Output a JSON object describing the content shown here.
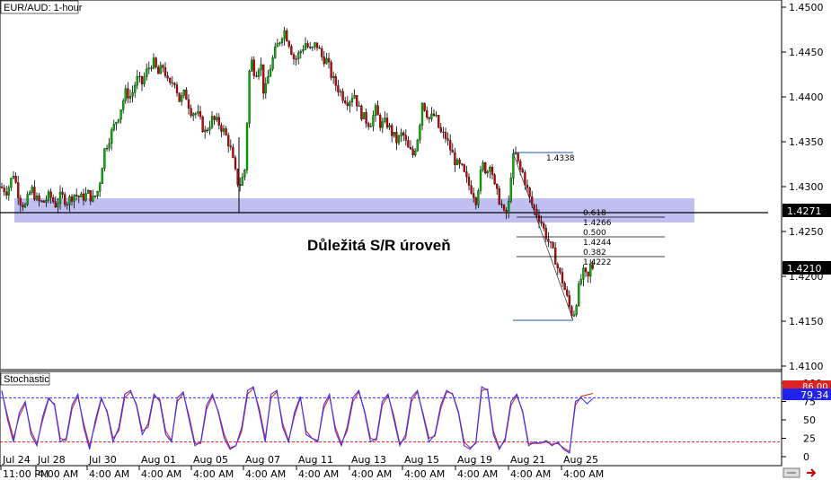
{
  "chart_title": "EUR/AUD: 1-hour",
  "indicator_title": "Stochastic",
  "annotation": "Důležitá S/R úroveň",
  "price_labels": {
    "current": "1.4210",
    "support": "1.4271"
  },
  "stoch_labels": {
    "k": "79.34",
    "d": "86.00"
  },
  "colors": {
    "up_candle": "#00b400",
    "down_candle": "#cc0000",
    "zone": "#8a8ae8",
    "fib_line": "#2255aa",
    "stoch_k": "#3333ff",
    "stoch_d": "#dd2222",
    "level_upper": "#3333ff",
    "level_lower": "#dd2222"
  },
  "chart_data": [
    {
      "type": "candlestick",
      "title": "EUR/AUD: 1-hour",
      "ylim": [
        1.408,
        1.45
      ],
      "yticks": [
        "1.4500",
        "1.4450",
        "1.4400",
        "1.4350",
        "1.4300",
        "1.4250",
        "1.4200",
        "1.4150",
        "1.4100"
      ],
      "x_ticks": [
        "Jul 24 11:00 PM",
        "Jul 28 4:00 AM",
        "Jul 30 4:00 AM",
        "Aug 01 4:00 AM",
        "Aug 05 4:00 AM",
        "Aug 07 4:00 AM",
        "Aug 11 4:00 AM",
        "Aug 13 4:00 AM",
        "Aug 15 4:00 AM",
        "Aug 19 4:00 AM",
        "Aug 21 4:00 AM",
        "Aug 25 4:00 AM"
      ],
      "price_path": [
        [
          0,
          1.43
        ],
        [
          8,
          1.4295
        ],
        [
          15,
          1.4315
        ],
        [
          22,
          1.4285
        ],
        [
          28,
          1.4278
        ],
        [
          35,
          1.4298
        ],
        [
          42,
          1.4283
        ],
        [
          48,
          1.4282
        ],
        [
          55,
          1.429
        ],
        [
          62,
          1.428
        ],
        [
          68,
          1.429
        ],
        [
          75,
          1.4283
        ],
        [
          82,
          1.4292
        ],
        [
          90,
          1.4287
        ],
        [
          98,
          1.4292
        ],
        [
          104,
          1.4285
        ],
        [
          110,
          1.4298
        ],
        [
          116,
          1.434
        ],
        [
          124,
          1.436
        ],
        [
          132,
          1.438
        ],
        [
          140,
          1.4405
        ],
        [
          146,
          1.44
        ],
        [
          152,
          1.442
        ],
        [
          158,
          1.4415
        ],
        [
          164,
          1.443
        ],
        [
          170,
          1.444
        ],
        [
          176,
          1.4425
        ],
        [
          182,
          1.4435
        ],
        [
          188,
          1.441
        ],
        [
          194,
          1.442
        ],
        [
          200,
          1.4395
        ],
        [
          206,
          1.4405
        ],
        [
          212,
          1.4385
        ],
        [
          220,
          1.438
        ],
        [
          228,
          1.436
        ],
        [
          236,
          1.4375
        ],
        [
          244,
          1.437
        ],
        [
          250,
          1.436
        ],
        [
          256,
          1.4345
        ],
        [
          262,
          1.4315
        ],
        [
          266,
          1.43
        ],
        [
          270,
          1.431
        ],
        [
          274,
          1.4325
        ],
        [
          276,
          1.442
        ],
        [
          280,
          1.444
        ],
        [
          284,
          1.4425
        ],
        [
          290,
          1.444
        ],
        [
          294,
          1.44
        ],
        [
          300,
          1.443
        ],
        [
          306,
          1.445
        ],
        [
          312,
          1.4465
        ],
        [
          316,
          1.4475
        ],
        [
          322,
          1.446
        ],
        [
          328,
          1.444
        ],
        [
          334,
          1.445
        ],
        [
          340,
          1.446
        ],
        [
          346,
          1.445
        ],
        [
          352,
          1.446
        ],
        [
          358,
          1.4445
        ],
        [
          364,
          1.444
        ],
        [
          370,
          1.442
        ],
        [
          376,
          1.441
        ],
        [
          382,
          1.44
        ],
        [
          388,
          1.4395
        ],
        [
          394,
          1.4405
        ],
        [
          400,
          1.4385
        ],
        [
          406,
          1.4375
        ],
        [
          412,
          1.437
        ],
        [
          418,
          1.4385
        ],
        [
          424,
          1.4368
        ],
        [
          430,
          1.4372
        ],
        [
          436,
          1.436
        ],
        [
          442,
          1.435
        ],
        [
          448,
          1.436
        ],
        [
          454,
          1.4342
        ],
        [
          460,
          1.4335
        ],
        [
          466,
          1.436
        ],
        [
          470,
          1.4395
        ],
        [
          474,
          1.4385
        ],
        [
          478,
          1.4375
        ],
        [
          484,
          1.438
        ],
        [
          490,
          1.436
        ],
        [
          496,
          1.4355
        ],
        [
          502,
          1.434
        ],
        [
          508,
          1.4325
        ],
        [
          514,
          1.432
        ],
        [
          520,
          1.4305
        ],
        [
          526,
          1.4295
        ],
        [
          530,
          1.4285
        ],
        [
          534,
          1.431
        ],
        [
          538,
          1.4325
        ],
        [
          542,
          1.4315
        ],
        [
          546,
          1.433
        ],
        [
          550,
          1.43
        ],
        [
          554,
          1.429
        ],
        [
          558,
          1.428
        ],
        [
          562,
          1.4265
        ],
        [
          566,
          1.4278
        ],
        [
          570,
          1.433
        ],
        [
          574,
          1.4335
        ],
        [
          578,
          1.432
        ],
        [
          582,
          1.4315
        ],
        [
          586,
          1.43
        ],
        [
          590,
          1.4285
        ],
        [
          594,
          1.4275
        ],
        [
          598,
          1.427
        ],
        [
          602,
          1.4262
        ],
        [
          606,
          1.425
        ],
        [
          610,
          1.424
        ],
        [
          614,
          1.423
        ],
        [
          618,
          1.422
        ],
        [
          622,
          1.4205
        ],
        [
          626,
          1.4195
        ],
        [
          630,
          1.418
        ],
        [
          634,
          1.4165
        ],
        [
          638,
          1.4155
        ],
        [
          642,
          1.4175
        ],
        [
          646,
          1.4195
        ],
        [
          650,
          1.4205
        ],
        [
          654,
          1.4195
        ],
        [
          658,
          1.4215
        ],
        [
          660,
          1.421
        ]
      ],
      "support_level": 1.4271,
      "zone": [
        1.426,
        1.4287
      ],
      "fib_high": {
        "price": 1.4338,
        "label": "1.4338"
      },
      "fib_low": {
        "price": 1.4151
      },
      "fib_levels": [
        {
          "ratio": "0.618",
          "price": 1.4266,
          "price_label": "1.4266"
        },
        {
          "ratio": "0.500",
          "price": 1.4244,
          "price_label": "1.4244"
        },
        {
          "ratio": "0.382",
          "price": 1.4222,
          "price_label": "1.4222"
        }
      ]
    },
    {
      "type": "line",
      "title": "Stochastic",
      "ylim": [
        0,
        100
      ],
      "yticks": [
        "100",
        "75",
        "50",
        "25",
        "0"
      ],
      "levels": [
        80,
        20
      ],
      "series": [
        {
          "name": "%K",
          "values": [
            90,
            50,
            20,
            60,
            75,
            30,
            15,
            55,
            80,
            70,
            20,
            25,
            70,
            85,
            40,
            10,
            50,
            80,
            60,
            20,
            40,
            85,
            90,
            70,
            30,
            45,
            85,
            75,
            30,
            20,
            80,
            88,
            50,
            15,
            20,
            70,
            85,
            60,
            25,
            10,
            15,
            40,
            90,
            95,
            60,
            20,
            85,
            90,
            40,
            20,
            60,
            82,
            30,
            25,
            20,
            70,
            85,
            35,
            15,
            40,
            80,
            90,
            60,
            20,
            25,
            75,
            85,
            50,
            15,
            30,
            80,
            90,
            55,
            20,
            30,
            70,
            90,
            85,
            60,
            15,
            10,
            20,
            95,
            90,
            30,
            10,
            25,
            75,
            85,
            60,
            15,
            20,
            18,
            22,
            15,
            20,
            10,
            5,
            75,
            80,
            72,
            79
          ]
        },
        {
          "name": "%D",
          "values": [
            88,
            55,
            25,
            55,
            72,
            35,
            18,
            50,
            78,
            72,
            25,
            22,
            65,
            82,
            45,
            15,
            45,
            78,
            62,
            25,
            35,
            80,
            88,
            72,
            35,
            40,
            82,
            78,
            35,
            22,
            75,
            86,
            55,
            18,
            18,
            65,
            82,
            62,
            30,
            12,
            15,
            35,
            85,
            93,
            65,
            25,
            80,
            88,
            45,
            22,
            55,
            80,
            35,
            25,
            22,
            65,
            82,
            40,
            18,
            35,
            75,
            88,
            62,
            25,
            22,
            70,
            83,
            55,
            18,
            25,
            75,
            88,
            58,
            25,
            28,
            65,
            88,
            86,
            62,
            20,
            12,
            18,
            90,
            92,
            35,
            12,
            22,
            70,
            83,
            62,
            18,
            18,
            18,
            20,
            17,
            18,
            12,
            7,
            70,
            82,
            84,
            86
          ]
        }
      ]
    }
  ]
}
